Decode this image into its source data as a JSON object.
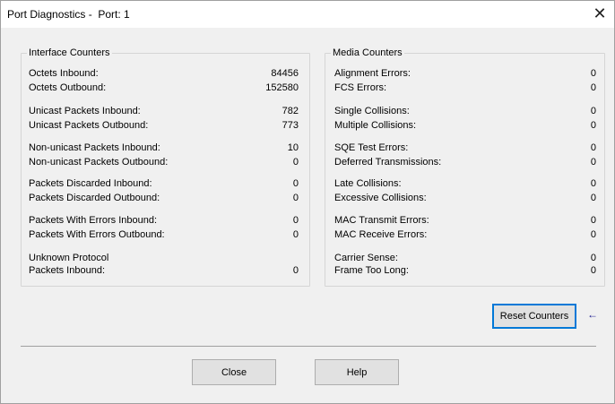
{
  "window": {
    "title": "Port Diagnostics -  Port: 1",
    "close_glyph": "✕"
  },
  "interface_counters": {
    "label": "Interface Counters",
    "rows": [
      {
        "label": "Octets Inbound:",
        "value": "84456"
      },
      {
        "label": "Octets Outbound:",
        "value": "152580"
      },
      {
        "label": "Unicast Packets Inbound:",
        "value": "782"
      },
      {
        "label": "Unicast Packets Outbound:",
        "value": "773"
      },
      {
        "label": "Non-unicast Packets Inbound:",
        "value": "10"
      },
      {
        "label": "Non-unicast Packets Outbound:",
        "value": "0"
      },
      {
        "label": "Packets Discarded Inbound:",
        "value": "0"
      },
      {
        "label": "Packets Discarded Outbound:",
        "value": "0"
      },
      {
        "label": "Packets With Errors Inbound:",
        "value": "0"
      },
      {
        "label": "Packets With Errors Outbound:",
        "value": "0"
      },
      {
        "label": "Unknown Protocol",
        "value": ""
      },
      {
        "label": "Packets Inbound:",
        "value": "0"
      }
    ]
  },
  "media_counters": {
    "label": "Media Counters",
    "rows": [
      {
        "label": "Alignment Errors:",
        "value": "0"
      },
      {
        "label": "FCS Errors:",
        "value": "0"
      },
      {
        "label": "Single Collisions:",
        "value": "0"
      },
      {
        "label": "Multiple Collisions:",
        "value": "0"
      },
      {
        "label": "SQE Test Errors:",
        "value": "0"
      },
      {
        "label": "Deferred Transmissions:",
        "value": "0"
      },
      {
        "label": "Late Collisions:",
        "value": "0"
      },
      {
        "label": "Excessive Collisions:",
        "value": "0"
      },
      {
        "label": "MAC Transmit Errors:",
        "value": "0"
      },
      {
        "label": "MAC Receive Errors:",
        "value": "0"
      },
      {
        "label": "Carrier Sense:",
        "value": "0"
      },
      {
        "label": "Frame Too Long:",
        "value": "0"
      }
    ]
  },
  "buttons": {
    "reset": "Reset Counters",
    "close": "Close",
    "help": "Help"
  },
  "pointer_glyph": "←"
}
